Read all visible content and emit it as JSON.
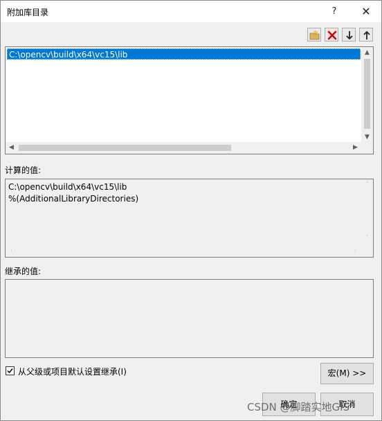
{
  "window": {
    "title": "附加库目录",
    "help_glyph": "?",
    "close_glyph": "✕"
  },
  "toolbar": {
    "new_line_icon": "new-folder-icon",
    "delete_icon": "red-x-icon",
    "move_down_icon": "arrow-down-icon",
    "move_up_icon": "arrow-up-icon"
  },
  "directories": {
    "items": [
      "C:\\opencv\\build\\x64\\vc15\\lib"
    ]
  },
  "evaluated": {
    "label": "计算的值:",
    "lines": [
      "C:\\opencv\\build\\x64\\vc15\\lib",
      "%(AdditionalLibraryDirectories)"
    ]
  },
  "inherited": {
    "label": "继承的值:"
  },
  "inherit": {
    "label": "从父级或项目默认设置继承(I)",
    "checked": true
  },
  "buttons": {
    "macros": "宏(M) >>",
    "ok": "确定",
    "cancel": "取消"
  },
  "watermark": "CSDN @脚踏实地GIS",
  "colors": {
    "selection": "#0078d7",
    "delete_red": "#d00000"
  }
}
